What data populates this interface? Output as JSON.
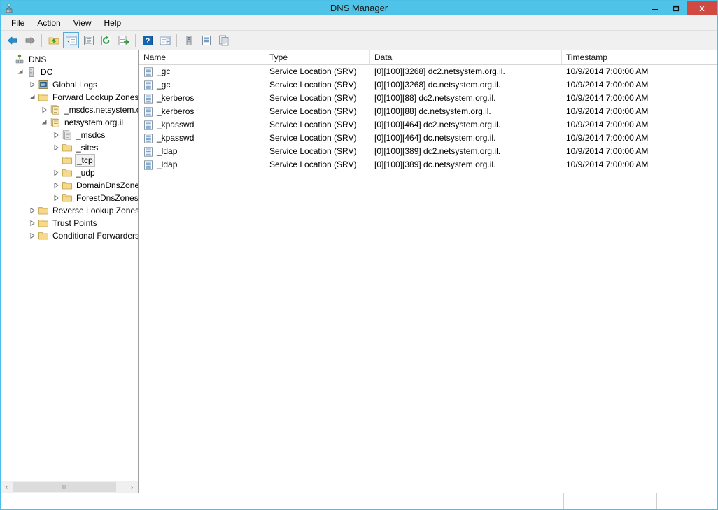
{
  "window": {
    "title": "DNS Manager",
    "icon": "dns-server-icon",
    "controls": {
      "minimize": "–",
      "maximize": "❐",
      "close": "x"
    }
  },
  "menubar": {
    "items": [
      {
        "label": "File",
        "name": "menu-file"
      },
      {
        "label": "Action",
        "name": "menu-action"
      },
      {
        "label": "View",
        "name": "menu-view"
      },
      {
        "label": "Help",
        "name": "menu-help"
      }
    ]
  },
  "toolbar": {
    "buttons": [
      {
        "name": "back-button",
        "icon": "back-arrow-icon",
        "active": false
      },
      {
        "name": "forward-button",
        "icon": "forward-arrow-icon",
        "active": false
      },
      {
        "name": "up-one-level-button",
        "icon": "folder-up-icon",
        "active": false
      },
      {
        "name": "show-hide-console-tree-button",
        "icon": "console-tree-icon",
        "active": true
      },
      {
        "name": "properties-button",
        "icon": "properties-icon",
        "active": false
      },
      {
        "name": "refresh-button",
        "icon": "refresh-icon",
        "active": false
      },
      {
        "name": "export-list-button",
        "icon": "export-list-icon",
        "active": false
      },
      {
        "name": "help-button",
        "icon": "help-icon",
        "active": false
      },
      {
        "name": "show-hide-action-pane-button",
        "icon": "action-pane-icon",
        "active": false
      },
      {
        "name": "new-server-button",
        "icon": "server-icon",
        "active": false
      },
      {
        "name": "new-zone-button",
        "icon": "zone-record-icon",
        "active": false
      },
      {
        "name": "new-host-button",
        "icon": "copy-record-icon",
        "active": false
      }
    ]
  },
  "tree": {
    "nodes": [
      {
        "name": "tree-node-dns",
        "label": "DNS",
        "indent": 0,
        "arrow": "none",
        "icon": "dns-root-icon"
      },
      {
        "name": "tree-node-dc",
        "label": "DC",
        "indent": 1,
        "arrow": "expanded",
        "icon": "server-icon"
      },
      {
        "name": "tree-node-global-logs",
        "label": "Global Logs",
        "indent": 2,
        "arrow": "collapsed",
        "icon": "global-logs-icon"
      },
      {
        "name": "tree-node-forward-lookup-zones",
        "label": "Forward Lookup Zones",
        "indent": 2,
        "arrow": "expanded",
        "icon": "folder-icon"
      },
      {
        "name": "tree-node-msdcs-netsystem",
        "label": "_msdcs.netsystem.or",
        "indent": 3,
        "arrow": "collapsed",
        "icon": "zone-icon"
      },
      {
        "name": "tree-node-netsystem-org-il",
        "label": "netsystem.org.il",
        "indent": 3,
        "arrow": "expanded",
        "icon": "zone-icon"
      },
      {
        "name": "tree-node-msdcs",
        "label": "_msdcs",
        "indent": 4,
        "arrow": "collapsed",
        "icon": "delegated-zone-icon"
      },
      {
        "name": "tree-node-sites",
        "label": "_sites",
        "indent": 4,
        "arrow": "collapsed",
        "icon": "folder-icon"
      },
      {
        "name": "tree-node-tcp",
        "label": "_tcp",
        "indent": 4,
        "arrow": "none",
        "icon": "folder-icon",
        "selected": true
      },
      {
        "name": "tree-node-udp",
        "label": "_udp",
        "indent": 4,
        "arrow": "collapsed",
        "icon": "folder-icon"
      },
      {
        "name": "tree-node-domaindnszones",
        "label": "DomainDnsZones",
        "indent": 4,
        "arrow": "collapsed",
        "icon": "folder-icon"
      },
      {
        "name": "tree-node-forestdnszones",
        "label": "ForestDnsZones",
        "indent": 4,
        "arrow": "collapsed",
        "icon": "folder-icon"
      },
      {
        "name": "tree-node-reverse-lookup-zones",
        "label": "Reverse Lookup Zones",
        "indent": 2,
        "arrow": "collapsed",
        "icon": "folder-icon"
      },
      {
        "name": "tree-node-trust-points",
        "label": "Trust Points",
        "indent": 2,
        "arrow": "collapsed",
        "icon": "folder-icon"
      },
      {
        "name": "tree-node-conditional-forwarders",
        "label": "Conditional Forwarders",
        "indent": 2,
        "arrow": "collapsed",
        "icon": "folder-icon"
      }
    ],
    "hscroll": {
      "left_arrow": "‹",
      "right_arrow": "›",
      "grip": "‖‖"
    }
  },
  "list": {
    "columns": [
      {
        "name": "column-name",
        "label": "Name"
      },
      {
        "name": "column-type",
        "label": "Type"
      },
      {
        "name": "column-data",
        "label": "Data"
      },
      {
        "name": "column-timestamp",
        "label": "Timestamp"
      },
      {
        "name": "column-blank",
        "label": ""
      }
    ],
    "rows": [
      {
        "icon": "srv-record-icon",
        "name": "_gc",
        "type": "Service Location (SRV)",
        "data": "[0][100][3268] dc2.netsystem.org.il.",
        "timestamp": "10/9/2014 7:00:00 AM"
      },
      {
        "icon": "srv-record-icon",
        "name": "_gc",
        "type": "Service Location (SRV)",
        "data": "[0][100][3268] dc.netsystem.org.il.",
        "timestamp": "10/9/2014 7:00:00 AM"
      },
      {
        "icon": "srv-record-icon",
        "name": "_kerberos",
        "type": "Service Location (SRV)",
        "data": "[0][100][88] dc2.netsystem.org.il.",
        "timestamp": "10/9/2014 7:00:00 AM"
      },
      {
        "icon": "srv-record-icon",
        "name": "_kerberos",
        "type": "Service Location (SRV)",
        "data": "[0][100][88] dc.netsystem.org.il.",
        "timestamp": "10/9/2014 7:00:00 AM"
      },
      {
        "icon": "srv-record-icon",
        "name": "_kpasswd",
        "type": "Service Location (SRV)",
        "data": "[0][100][464] dc2.netsystem.org.il.",
        "timestamp": "10/9/2014 7:00:00 AM"
      },
      {
        "icon": "srv-record-icon",
        "name": "_kpasswd",
        "type": "Service Location (SRV)",
        "data": "[0][100][464] dc.netsystem.org.il.",
        "timestamp": "10/9/2014 7:00:00 AM"
      },
      {
        "icon": "srv-record-icon",
        "name": "_ldap",
        "type": "Service Location (SRV)",
        "data": "[0][100][389] dc2.netsystem.org.il.",
        "timestamp": "10/9/2014 7:00:00 AM"
      },
      {
        "icon": "srv-record-icon",
        "name": "_ldap",
        "type": "Service Location (SRV)",
        "data": "[0][100][389] dc.netsystem.org.il.",
        "timestamp": "10/9/2014 7:00:00 AM"
      }
    ]
  },
  "statusbar": {
    "segments": [
      "",
      "",
      ""
    ]
  },
  "colors": {
    "titlebar": "#4fc3e8",
    "close_button": "#d04a41",
    "toolbar_background": "#f0f0f0",
    "folder": "#f6d98a",
    "accent_selected_toolbar": "#dff0fa"
  }
}
